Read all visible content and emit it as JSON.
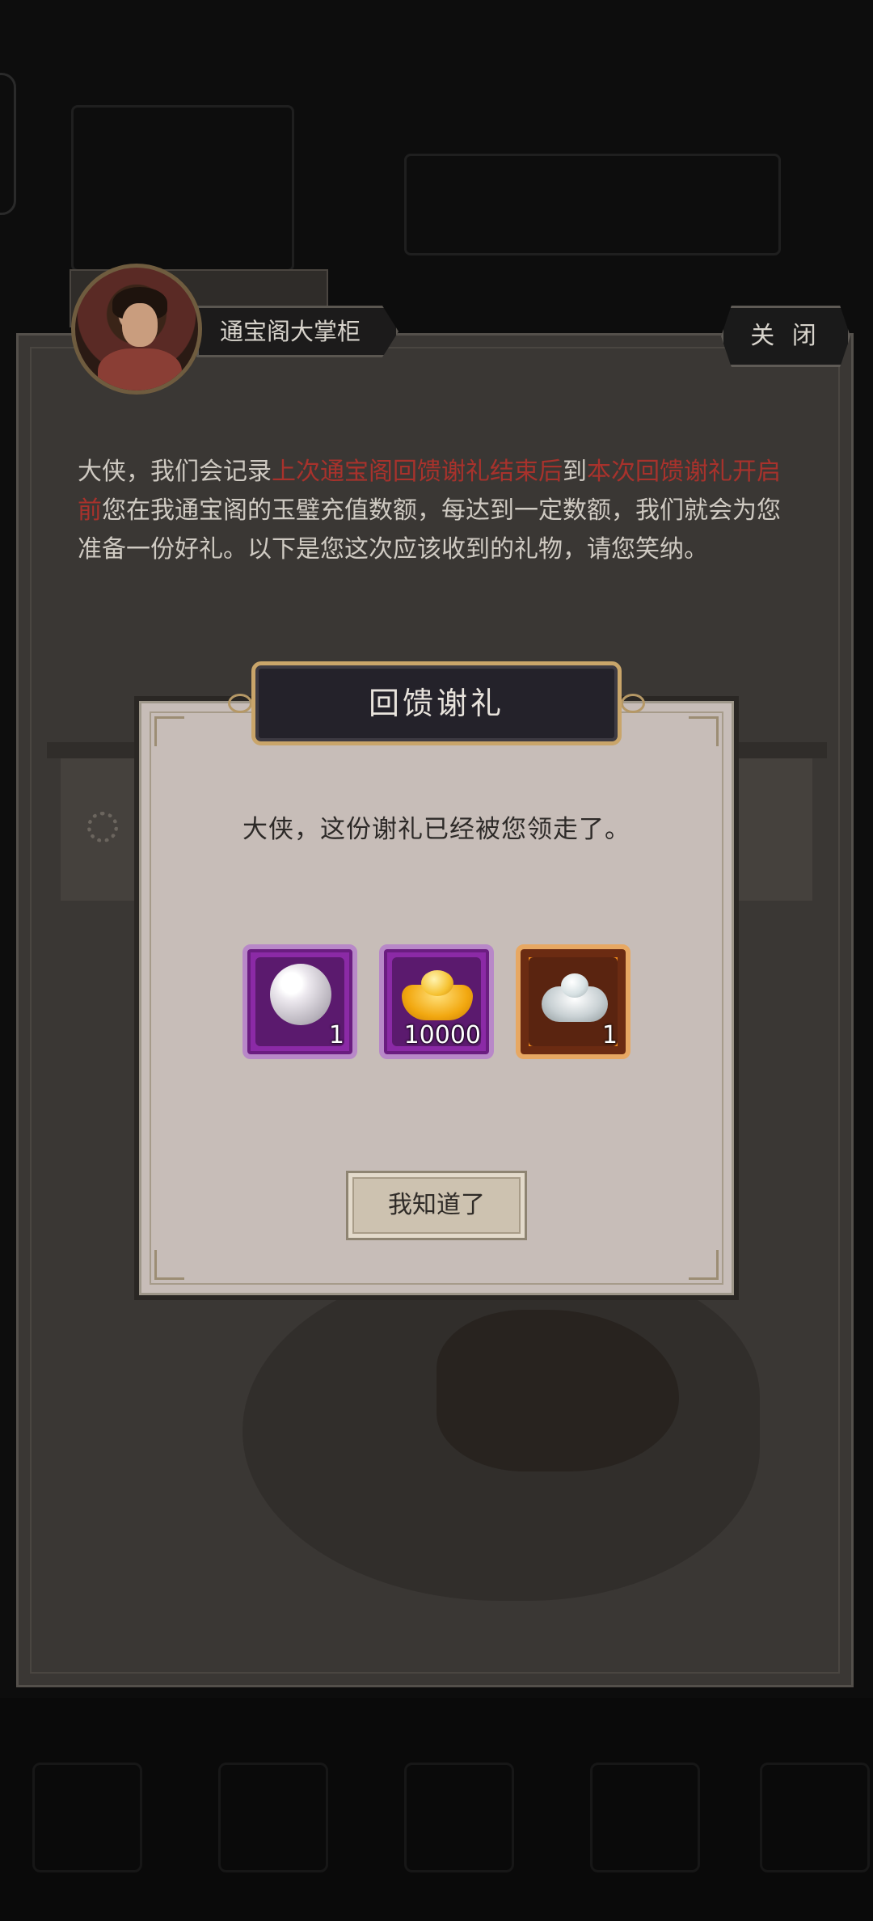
{
  "header": {
    "npc_name": "通宝阁大掌柜",
    "close_label": "关 闭"
  },
  "intro": {
    "part1": "大侠，我们会记录",
    "highlight1": "上次通宝阁回馈谢礼结束后",
    "part2": "到",
    "highlight2": "本次回馈谢礼开启前",
    "part3": "您在我通宝阁的玉璧充值数额，每达到一定数额，我们就会为您准备一份好礼。以下是您这次应该收到的礼物，请您笑纳。"
  },
  "dialog": {
    "title": "回馈谢礼",
    "message": "大侠，这份谢礼已经被您领走了。",
    "confirm_label": "我知道了",
    "rewards": [
      {
        "icon": "pearl-icon",
        "rarity": "purple",
        "count": "1"
      },
      {
        "icon": "gold-ingot-icon",
        "rarity": "purple",
        "count": "10000"
      },
      {
        "icon": "silver-ingot-icon",
        "rarity": "orange",
        "count": "1"
      }
    ]
  },
  "colors": {
    "highlight": "#a8322c",
    "rarity_purple": "#8b2aa6",
    "rarity_orange": "#f08a1a",
    "title_border": "#c9a56a"
  }
}
